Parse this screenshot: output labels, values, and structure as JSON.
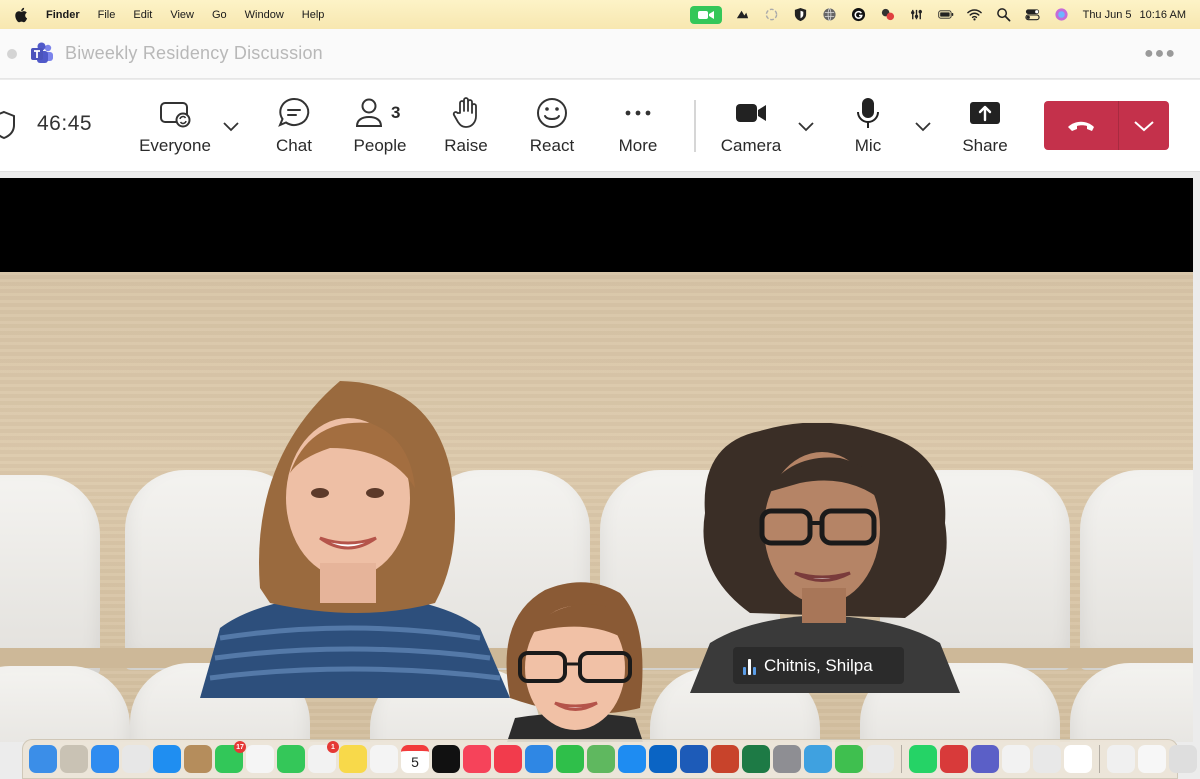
{
  "menubar": {
    "app_name": "Finder",
    "menus": [
      "File",
      "Edit",
      "View",
      "Go",
      "Window",
      "Help"
    ],
    "date": "Thu Jun 5",
    "time": "10:16 AM"
  },
  "window": {
    "title": "Biweekly Residency Discussion"
  },
  "toolbar": {
    "timer": "46:45",
    "everyone_label": "Everyone",
    "chat_label": "Chat",
    "people_label": "People",
    "people_count": "3",
    "raise_label": "Raise",
    "react_label": "React",
    "more_label": "More",
    "camera_label": "Camera",
    "mic_label": "Mic",
    "share_label": "Share"
  },
  "meeting": {
    "speaker_name": "Chitnis, Shilpa",
    "participants_visible": 3
  },
  "dock": {
    "calendar_day": "5",
    "apps": [
      {
        "name": "finder-icon",
        "color": "#3b8ee8"
      },
      {
        "name": "uttyler-icon",
        "color": "#c9c2b4"
      },
      {
        "name": "mail-icon",
        "color": "#2f8cf0"
      },
      {
        "name": "launchpad-icon",
        "color": "#e7e7e7"
      },
      {
        "name": "safari-icon",
        "color": "#1f8ef1"
      },
      {
        "name": "contacts-icon",
        "color": "#b58d5c"
      },
      {
        "name": "messages-icon",
        "color": "#32c759",
        "badge": "17"
      },
      {
        "name": "photos-icon",
        "color": "#f5f5f5"
      },
      {
        "name": "facetime-icon",
        "color": "#34c759"
      },
      {
        "name": "reminders-icon",
        "color": "#f2f2f2",
        "badge": "1"
      },
      {
        "name": "notes-icon",
        "color": "#f8d94a"
      },
      {
        "name": "freeform-icon",
        "color": "#f4f4f4"
      },
      {
        "name": "calendar-icon",
        "color": "#ffffff"
      },
      {
        "name": "apple-tv-icon",
        "color": "#111111"
      },
      {
        "name": "music-icon",
        "color": "#f6435a"
      },
      {
        "name": "news-icon",
        "color": "#f23b4c"
      },
      {
        "name": "keynote-icon",
        "color": "#2f87e4"
      },
      {
        "name": "numbers-icon",
        "color": "#2fbf4a"
      },
      {
        "name": "maps-icon",
        "color": "#5fb85f"
      },
      {
        "name": "app-store-icon",
        "color": "#1e8cf2"
      },
      {
        "name": "outlook-icon",
        "color": "#0a64c4"
      },
      {
        "name": "word-icon",
        "color": "#1d5bb8"
      },
      {
        "name": "powerpoint-icon",
        "color": "#c8432b"
      },
      {
        "name": "excel-icon",
        "color": "#1d7a45"
      },
      {
        "name": "settings-icon",
        "color": "#8e8e93"
      },
      {
        "name": "affinity-icon",
        "color": "#3fa1e0"
      },
      {
        "name": "screen-share-icon",
        "color": "#3fbf4f"
      },
      {
        "name": "phone-mirror-icon",
        "color": "#e9e9e9"
      },
      {
        "name": "whatsapp-icon",
        "color": "#25d366"
      },
      {
        "name": "shield-vpn-icon",
        "color": "#d83a3a"
      },
      {
        "name": "teams-icon",
        "color": "#5b5fc7"
      },
      {
        "name": "language-icon",
        "color": "#f2f2f2"
      },
      {
        "name": "keychain-icon",
        "color": "#e8e8e8"
      },
      {
        "name": "chrome-icon",
        "color": "#ffffff"
      },
      {
        "name": "preview-icon",
        "color": "#f0f0f0"
      },
      {
        "name": "document-icon",
        "color": "#f7f7f7"
      },
      {
        "name": "trash-icon",
        "color": "#dedede"
      }
    ]
  }
}
